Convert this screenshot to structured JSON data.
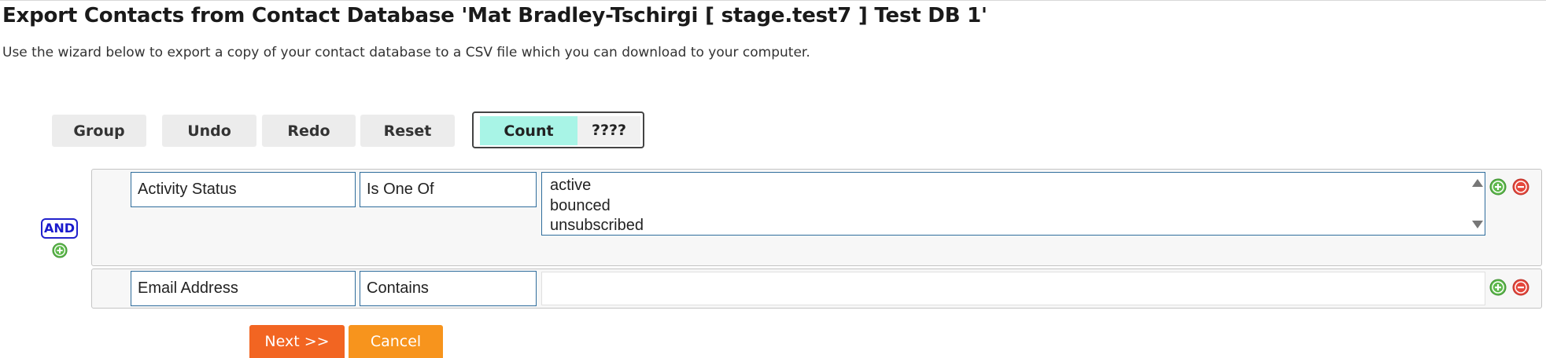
{
  "page": {
    "title": "Export Contacts from Contact Database 'Mat Bradley-Tschirgi [ stage.test7 ] Test DB 1'",
    "description": "Use the wizard below to export a copy of your contact database to a CSV file which you can download to your computer."
  },
  "toolbar": {
    "group_label": "Group",
    "undo_label": "Undo",
    "redo_label": "Redo",
    "reset_label": "Reset",
    "count_label": "Count",
    "count_result": "????"
  },
  "query": {
    "logic_label": "AND",
    "rules": [
      {
        "field": "Activity Status",
        "operator": "Is One Of",
        "values": [
          "active",
          "bounced",
          "unsubscribed"
        ]
      },
      {
        "field": "Email Address",
        "operator": "Contains",
        "value": ""
      }
    ]
  },
  "footer": {
    "next_label": "Next >>",
    "cancel_label": "Cancel"
  },
  "colors": {
    "count_button": "#a8f4e6",
    "and_badge": "#1a1acc",
    "add_icon": "#5cb84a",
    "remove_icon": "#e5473c",
    "next_button": "#f26522",
    "cancel_button": "#f7941d",
    "field_border": "#2f6d9c"
  },
  "icons": {
    "add": "plus-circle-icon",
    "remove": "minus-circle-icon",
    "scroll_up": "triangle-up-icon",
    "scroll_down": "triangle-down-icon"
  }
}
